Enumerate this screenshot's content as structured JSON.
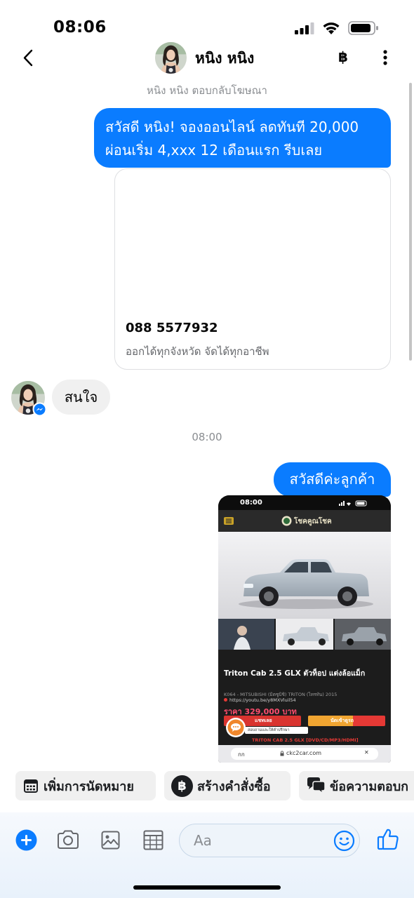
{
  "status_bar": {
    "time": "08:06",
    "icons": [
      "signal-icon",
      "wifi-icon",
      "battery-icon"
    ]
  },
  "header": {
    "name": "หนิง หนิง",
    "subtitle": "หนิง หนิง ตอบกลับโฆษณา",
    "baht_symbol": "฿",
    "icons": [
      "back-chevron-icon",
      "avatar",
      "baht-icon",
      "more-vertical-icon"
    ]
  },
  "messages": {
    "ad_bubble": {
      "line1": "สวัสดี หนิง! จองออนไลน์ ลดทันที 20,000",
      "line2": "ผ่อนเริ่ม 4,xxx 12 เดือนแรก รีบเลย"
    },
    "ad_card": {
      "phone": "088 5577932",
      "caption": "ออกได้ทุกจังหวัด จัดได้ทุกอาชีพ"
    },
    "received": {
      "text": "สนใจ"
    },
    "timestamp": "08:00",
    "reply": {
      "text": "สวัสดีค่ะลูกค้า"
    },
    "shared_image": {
      "status_time": "08:00",
      "logo_text": "โชคคูณโชค",
      "title": "Triton Cab 2.5 GLX ตัวท็อป แต่งล้อแม็ก",
      "subtitle": "K064 - MITSUBISHI (มิตซูบิชิ) TRITON (ไทรทัน) 2015",
      "link": "https://youtu.be/y8MXVluil54",
      "price": "ราคา 329,000 บาท",
      "chat_button": "แชทเลย",
      "visit_button": "นัดเข้าดูรถ",
      "chat_tooltip": "สอบถามและให้คำปรึกษา",
      "details_strip": "TRITON CAB 2.5 GLX [DVD/CD/MP3/HDMI]",
      "url_text_size": "กก",
      "url": "ckc2car.com",
      "url_close": "✕"
    }
  },
  "quick_actions": [
    {
      "label": "เพิ่มการนัดหมาย",
      "icon": "calendar-icon"
    },
    {
      "label": "สร้างคำสั่งซื้อ",
      "icon": "baht-circle-icon",
      "symbol": "฿"
    },
    {
      "label": "ข้อความตอบก",
      "icon": "chat-bubbles-icon"
    }
  ],
  "composer": {
    "placeholder": "Aa",
    "icons": [
      "plus-icon",
      "camera-icon",
      "image-icon",
      "table-icon",
      "emoji-icon",
      "thumbs-up-icon"
    ]
  },
  "colors": {
    "messenger_blue": "#0a7cff",
    "bubble_gray": "#f0f0f0",
    "secondary_text": "#8a8d91"
  }
}
